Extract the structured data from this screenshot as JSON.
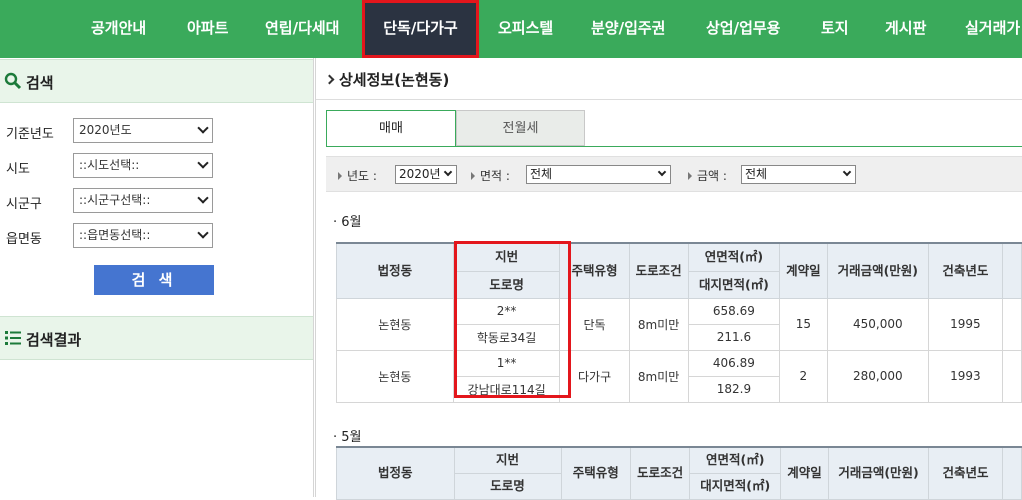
{
  "topnav": {
    "items": [
      "공개안내",
      "아파트",
      "연립/다세대",
      "단독/다가구",
      "오피스텔",
      "분양/입주권",
      "상업/업무용",
      "토지",
      "게시판",
      "실거래가"
    ],
    "active_index": 3
  },
  "sidebar": {
    "search_title": "검색",
    "fields": [
      {
        "label": "기준년도",
        "value": "2020년도"
      },
      {
        "label": "시도",
        "value": "::시도선택::"
      },
      {
        "label": "시군구",
        "value": "::시군구선택::"
      },
      {
        "label": "읍면동",
        "value": "::읍면동선택::"
      }
    ],
    "search_button": "검 색",
    "results_title": "검색결과"
  },
  "main": {
    "title": "상세정보(논현동)",
    "tabs": [
      "매매",
      "전월세"
    ],
    "active_tab": 0,
    "filters": {
      "year_label": "년도 :",
      "year_value": "2020년",
      "area_label": "면적 :",
      "area_value": "전체",
      "price_label": "금액 :",
      "price_value": "전체"
    },
    "headers": {
      "dong": "법정동",
      "jibun": "지번",
      "road": "도로명",
      "type": "주택유형",
      "road_cond": "도로조건",
      "floor_area": "연면적(㎡)",
      "land_area": "대지면적(㎡)",
      "contract": "계약일",
      "price": "거래금액(만원)",
      "built": "건축년도"
    },
    "sections": [
      {
        "month": "6월",
        "rows": [
          {
            "dong": "논현동",
            "jibun": "2**",
            "road": "학동로34길",
            "type": "단독",
            "road_cond": "8m미만",
            "floor_area": "658.69",
            "land_area": "211.6",
            "contract": "15",
            "price": "450,000",
            "built": "1995"
          },
          {
            "dong": "논현동",
            "jibun": "1**",
            "road": "강남대로114길",
            "type": "다가구",
            "road_cond": "8m미만",
            "floor_area": "406.89",
            "land_area": "182.9",
            "contract": "2",
            "price": "280,000",
            "built": "1993"
          }
        ]
      },
      {
        "month": "5월",
        "rows": []
      }
    ]
  },
  "colors": {
    "nav_green": "#3aaa5b",
    "active_tab_bg": "#2b3341",
    "highlight_red": "#e3161c",
    "search_button_blue": "#4575d0",
    "table_header_bg": "#e8eef4"
  }
}
